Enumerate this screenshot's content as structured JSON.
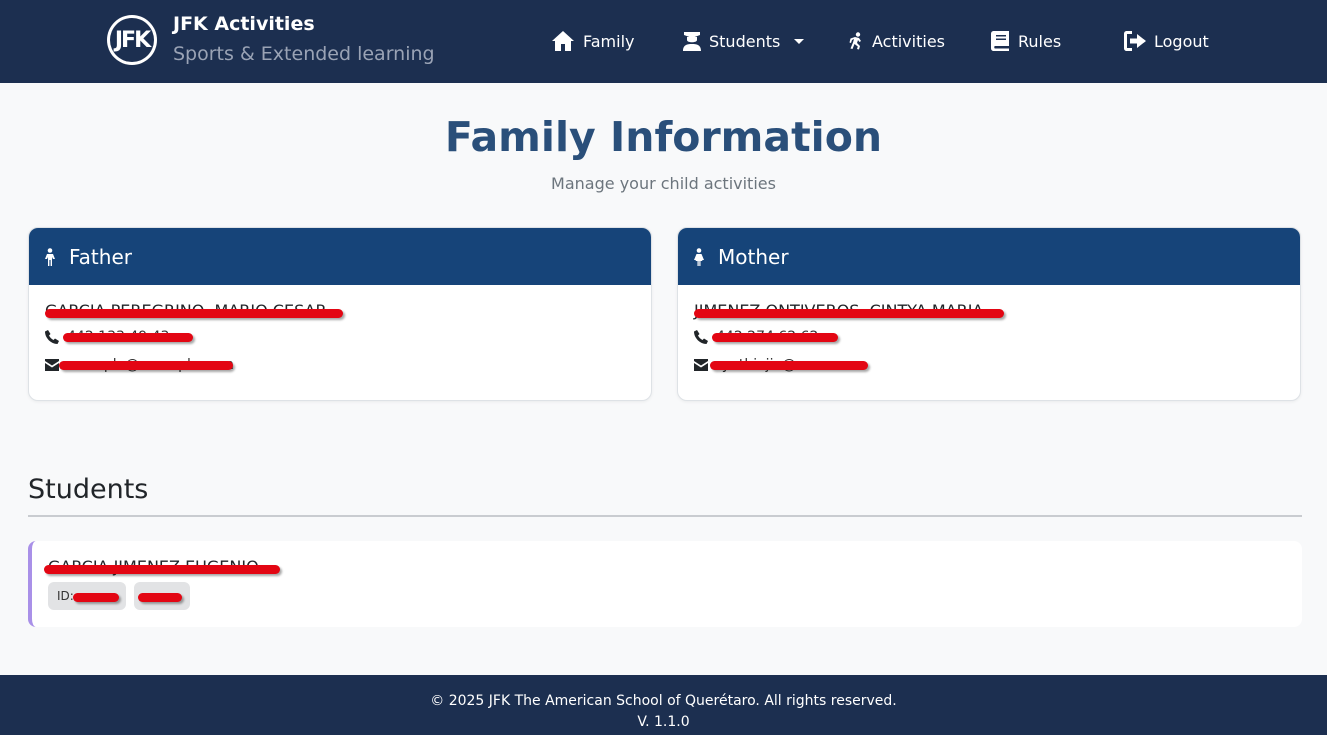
{
  "brand": {
    "logo_text": "JFK",
    "title": "JFK Activities",
    "subtitle": "Sports & Extended learning"
  },
  "nav": {
    "family": "Family",
    "students": "Students",
    "activities": "Activities",
    "rules": "Rules",
    "logout": "Logout"
  },
  "header": {
    "title": "Family Information",
    "subtitle": "Manage your child activities"
  },
  "father": {
    "heading": "Father",
    "name": "GARCIA PEREGRINO, MARIO CESAR",
    "phone": "442 133 49 43",
    "email": "example@example.com"
  },
  "mother": {
    "heading": "Mother",
    "name": "JIMENEZ ONTIVEROS, CINTYA MARIA",
    "phone": "442 274 62 62",
    "email": "cynthiajia@me.com"
  },
  "students": {
    "heading": "Students",
    "items": [
      {
        "name": "GARCIA JIMENEZ EUGENIO",
        "id_label": "ID:",
        "id_value": "000000",
        "grade": "00000"
      }
    ]
  },
  "footer": {
    "copyright": "© 2025 JFK The American School of Querétaro. All rights reserved.",
    "version": "V. 1.1.0"
  },
  "colors": {
    "navbar": "#1c2f50",
    "card_header": "#164479",
    "title": "#2a4f7a",
    "student_accent": "#a990e8",
    "redaction": "#e30613"
  }
}
